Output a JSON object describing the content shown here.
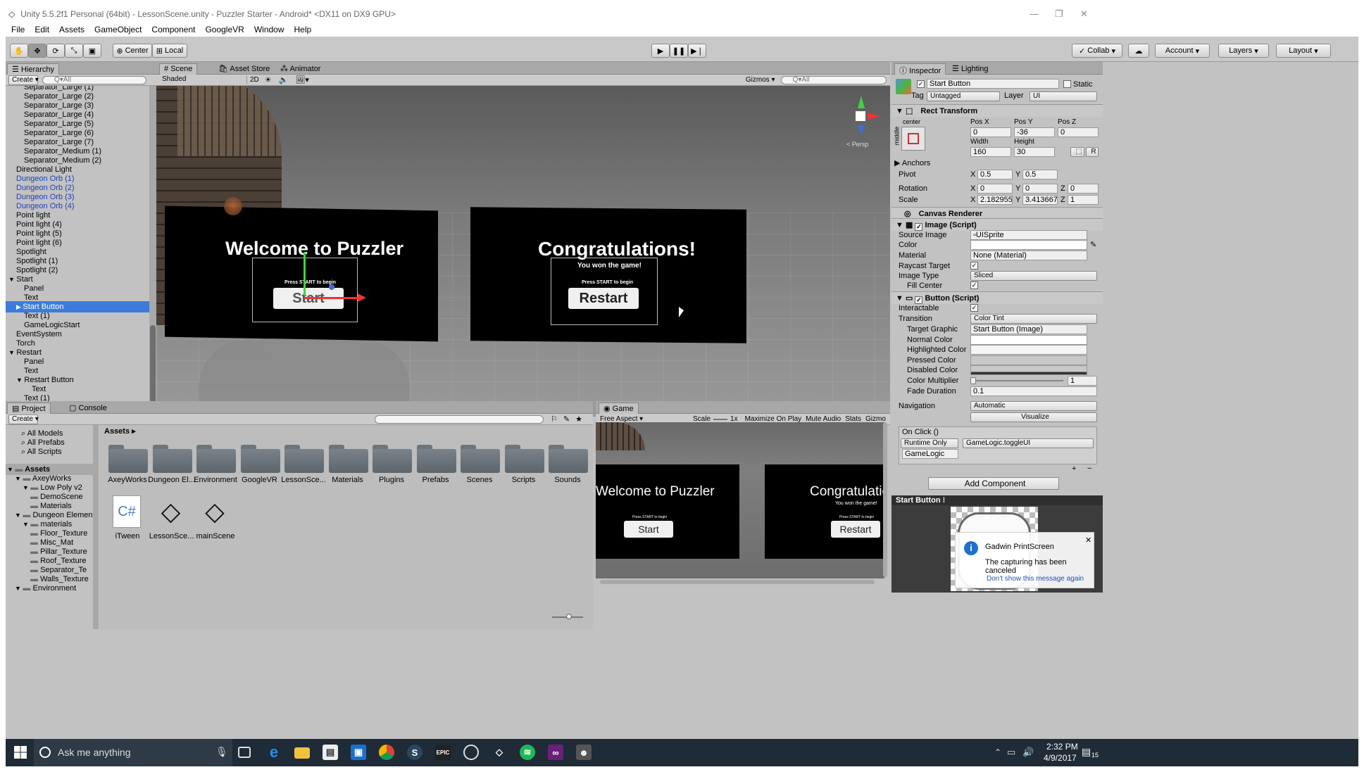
{
  "window": {
    "title": "Unity 5.5.2f1 Personal (64bit) - LessonScene.unity - Puzzler Starter - Android* <DX11 on DX9 GPU>"
  },
  "menu": [
    "File",
    "Edit",
    "Assets",
    "GameObject",
    "Component",
    "GoogleVR",
    "Window",
    "Help"
  ],
  "toolbar": {
    "pivot": "Center",
    "space": "Local",
    "collab": "Collab",
    "account": "Account",
    "layers": "Layers",
    "layout": "Layout"
  },
  "hierarchy": {
    "tab": "Hierarchy",
    "create": "Create",
    "search_placeholder": "Q▾All",
    "rows": [
      {
        "label": "Separator_Large (1)",
        "indent": 2
      },
      {
        "label": "Separator_Large (2)",
        "indent": 2
      },
      {
        "label": "Separator_Large (3)",
        "indent": 2
      },
      {
        "label": "Separator_Large (4)",
        "indent": 2
      },
      {
        "label": "Separator_Large (5)",
        "indent": 2
      },
      {
        "label": "Separator_Large (6)",
        "indent": 2
      },
      {
        "label": "Separator_Large (7)",
        "indent": 2
      },
      {
        "label": "Separator_Medium (1)",
        "indent": 2
      },
      {
        "label": "Separator_Medium (2)",
        "indent": 2
      },
      {
        "label": "Directional Light",
        "indent": 1
      },
      {
        "label": "Dungeon Orb (1)",
        "indent": 1,
        "prefab": true
      },
      {
        "label": "Dungeon Orb (2)",
        "indent": 1,
        "prefab": true
      },
      {
        "label": "Dungeon Orb (3)",
        "indent": 1,
        "prefab": true
      },
      {
        "label": "Dungeon Orb (4)",
        "indent": 1,
        "prefab": true
      },
      {
        "label": "Point light",
        "indent": 1
      },
      {
        "label": "Point light (4)",
        "indent": 1
      },
      {
        "label": "Point light (5)",
        "indent": 1
      },
      {
        "label": "Point light (6)",
        "indent": 1
      },
      {
        "label": "Spotlight",
        "indent": 1
      },
      {
        "label": "Spotlight (1)",
        "indent": 1
      },
      {
        "label": "Spotlight (2)",
        "indent": 1
      },
      {
        "label": "Start",
        "indent": 1,
        "arrow": "▼"
      },
      {
        "label": "Panel",
        "indent": 2
      },
      {
        "label": "Text",
        "indent": 2
      },
      {
        "label": "Start Button",
        "indent": 2,
        "arrow": "▶",
        "selected": true
      },
      {
        "label": "Text (1)",
        "indent": 2
      },
      {
        "label": "GameLogicStart",
        "indent": 2
      },
      {
        "label": "EventSystem",
        "indent": 1
      },
      {
        "label": "Torch",
        "indent": 1
      },
      {
        "label": "Restart",
        "indent": 1,
        "arrow": "▼"
      },
      {
        "label": "Panel",
        "indent": 2
      },
      {
        "label": "Text",
        "indent": 2
      },
      {
        "label": "Restart Button",
        "indent": 2,
        "arrow": "▼"
      },
      {
        "label": "Text",
        "indent": 3
      },
      {
        "label": "Text (1)",
        "indent": 2
      },
      {
        "label": "Text (2)",
        "indent": 2
      },
      {
        "label": "GameLogicRestart",
        "indent": 2
      }
    ]
  },
  "scene": {
    "tabs": [
      "Scene",
      "Asset Store",
      "Animator"
    ],
    "shading": "Shaded",
    "mode2d": "2D",
    "gizmos": "Gizmos",
    "search_placeholder": "Q▾All",
    "persp": "< Persp",
    "welcome_title": "Welcome to Puzzler",
    "press_start": "Press START to begin",
    "start_label": "Start",
    "congrats_title": "Congratulations!",
    "won_text": "You won the game!",
    "restart_label": "Restart"
  },
  "project": {
    "tabs": [
      "Project",
      "Console"
    ],
    "create": "Create",
    "favorites": [
      "All Models",
      "All Prefabs",
      "All Scripts"
    ],
    "tree": [
      {
        "label": "Assets",
        "indent": 0,
        "arrow": "▼",
        "bold": true
      },
      {
        "label": "AxeyWorks",
        "indent": 1,
        "arrow": "▼"
      },
      {
        "label": "Low Poly v2",
        "indent": 2,
        "arrow": "▼"
      },
      {
        "label": "DemoScene",
        "indent": 3
      },
      {
        "label": "Materials",
        "indent": 3
      },
      {
        "label": "Dungeon Elements",
        "indent": 1,
        "arrow": "▼"
      },
      {
        "label": "materials",
        "indent": 2,
        "arrow": "▼"
      },
      {
        "label": "Floor_Texture",
        "indent": 3
      },
      {
        "label": "Misc_Mat",
        "indent": 3
      },
      {
        "label": "Pillar_Texture",
        "indent": 3
      },
      {
        "label": "Roof_Texture",
        "indent": 3
      },
      {
        "label": "Separator_Te",
        "indent": 3
      },
      {
        "label": "Walls_Texture",
        "indent": 3
      },
      {
        "label": "Environment",
        "indent": 1,
        "arrow": "▼"
      }
    ],
    "breadcrumb": "Assets ▸",
    "folders": [
      "AxeyWorks",
      "Dungeon El...",
      "Environment",
      "GoogleVR",
      "LessonSce...",
      "Materials",
      "Plugins",
      "Prefabs",
      "Scenes",
      "Scripts",
      "Sounds"
    ],
    "files": [
      {
        "label": "iTween",
        "icon": "csharp-script-icon"
      },
      {
        "label": "LessonSce...",
        "icon": "unity-scene-icon"
      },
      {
        "label": "mainScene",
        "icon": "unity-scene-icon"
      }
    ]
  },
  "game": {
    "tab": "Game",
    "aspect": "Free Aspect",
    "scale_label": "Scale",
    "scale_value": "1x",
    "maximize": "Maximize On Play",
    "mute": "Mute Audio",
    "stats": "Stats",
    "gizmos": "Gizmo",
    "welcome_title": "Welcome to Puzzler",
    "press_start": "Press START to begin",
    "start_label": "Start",
    "congrats_title": "Congratulation",
    "won_text": "You won the game!",
    "restart_label": "Restart"
  },
  "inspector": {
    "tabs": [
      "Inspector",
      "Lighting"
    ],
    "object_name": "Start Button",
    "static": "Static",
    "tag_label": "Tag",
    "tag_value": "Untagged",
    "layer_label": "Layer",
    "layer_value": "UI",
    "rect_transform": {
      "title": "Rect Transform",
      "anchor_h": "center",
      "anchor_v": "middle",
      "pos_x_label": "Pos X",
      "pos_x": "0",
      "pos_y_label": "Pos Y",
      "pos_y": "-36",
      "pos_z_label": "Pos Z",
      "pos_z": "0",
      "width_label": "Width",
      "width": "160",
      "height_label": "Height",
      "height": "30",
      "anchors": "Anchors",
      "pivot_label": "Pivot",
      "pivot_x": "0.5",
      "pivot_y": "0.5",
      "rotation_label": "Rotation",
      "rot_x": "0",
      "rot_y": "0",
      "rot_z": "0",
      "scale_label": "Scale",
      "scale_x": "2.182955",
      "scale_y": "3.413667",
      "scale_z": "1"
    },
    "canvas_renderer": "Canvas Renderer",
    "image_script": {
      "title": "Image (Script)",
      "source_image_label": "Source Image",
      "source_image": "UISprite",
      "color_label": "Color",
      "material_label": "Material",
      "material": "None (Material)",
      "raycast_label": "Raycast Target",
      "image_type_label": "Image Type",
      "image_type": "Sliced",
      "fill_center_label": "Fill Center"
    },
    "button_script": {
      "title": "Button (Script)",
      "interactable_label": "Interactable",
      "transition_label": "Transition",
      "transition": "Color Tint",
      "target_graphic_label": "Target Graphic",
      "target_graphic": "Start Button (Image)",
      "normal_color_label": "Normal Color",
      "highlighted_color_label": "Highlighted Color",
      "pressed_color_label": "Pressed Color",
      "disabled_color_label": "Disabled Color",
      "color_multiplier_label": "Color Multiplier",
      "color_multiplier": "1",
      "fade_duration_label": "Fade Duration",
      "fade_duration": "0.1",
      "navigation_label": "Navigation",
      "navigation": "Automatic",
      "visualize": "Visualize",
      "on_click": "On Click ()",
      "runtime": "Runtime Only",
      "function": "GameLogic.toggleUI",
      "object": "GameLogic"
    },
    "add_component": "Add Component",
    "preview_title": "Start Button"
  },
  "notification": {
    "title": "Gadwin PrintScreen",
    "message": "The capturing has been canceled",
    "link": "Don't show this message again"
  },
  "taskbar": {
    "search": "Ask me anything",
    "time": "2:32 PM",
    "date": "4/9/2017",
    "badge": "15"
  },
  "colors": {
    "selection": "#3d7bdb",
    "prefab_text": "#1f3fb8",
    "taskbar": "#1f2b36"
  }
}
